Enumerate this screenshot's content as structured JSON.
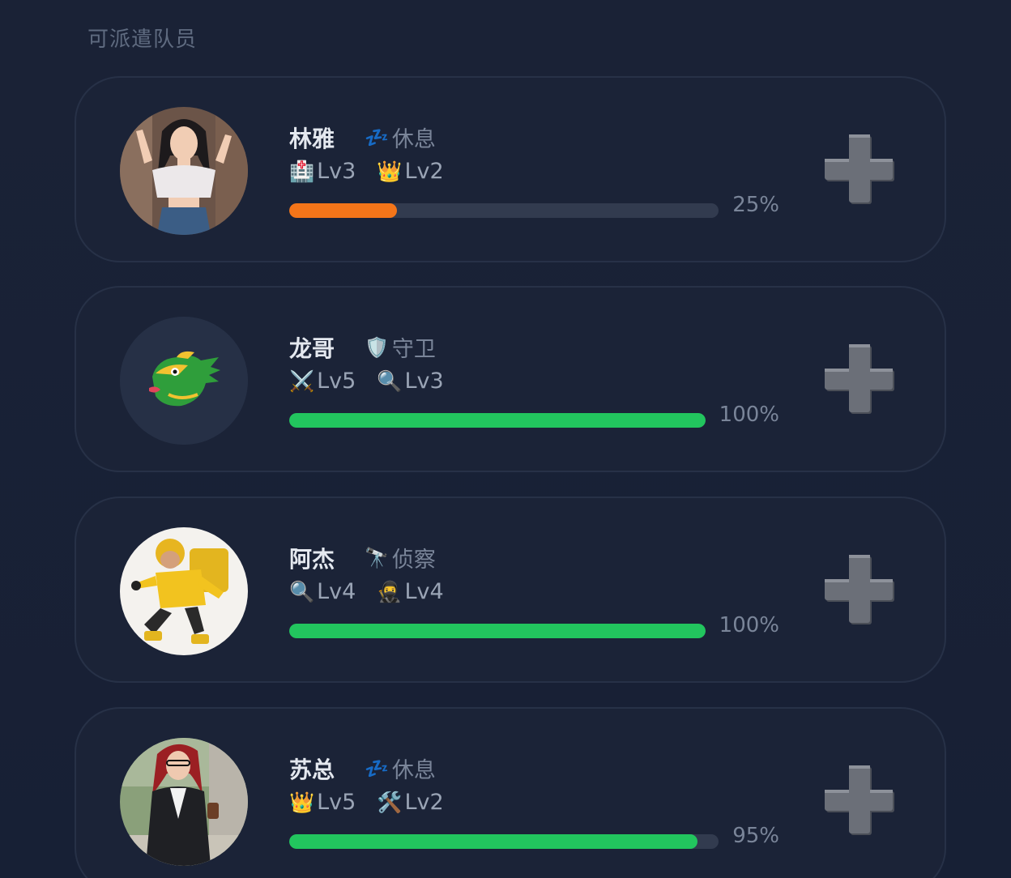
{
  "section_title": "可派遣队员",
  "colors": {
    "progress_low": "#f47519",
    "progress_high": "#22c55e"
  },
  "members": [
    {
      "name": "林雅",
      "status_icon": "zzz-sleep-icon",
      "status_glyph": "💤",
      "status": "休息",
      "skills": [
        {
          "icon": "hospital-icon",
          "glyph": "🏥",
          "label": "Lv3"
        },
        {
          "icon": "crown-icon",
          "glyph": "👑",
          "label": "Lv2"
        }
      ],
      "progress": 0.25,
      "progress_label": "25%",
      "progress_color": "#f47519",
      "avatar": "woman-photo-avatar"
    },
    {
      "name": "龙哥",
      "status_icon": "shield-icon",
      "status_glyph": "🛡️",
      "status": "守卫",
      "skills": [
        {
          "icon": "crossed-swords-icon",
          "glyph": "⚔️",
          "label": "Lv5"
        },
        {
          "icon": "magnifier-icon",
          "glyph": "🔍",
          "label": "Lv3"
        }
      ],
      "progress": 1.0,
      "progress_label": "100%",
      "progress_color": "#22c55e",
      "avatar": "dragon-emoji-avatar"
    },
    {
      "name": "阿杰",
      "status_icon": "telescope-icon",
      "status_glyph": "🔭",
      "status": "侦察",
      "skills": [
        {
          "icon": "magnifier-icon",
          "glyph": "🔍",
          "label": "Lv4"
        },
        {
          "icon": "ninja-icon",
          "glyph": "🥷",
          "label": "Lv4"
        }
      ],
      "progress": 1.0,
      "progress_label": "100%",
      "progress_color": "#22c55e",
      "avatar": "courier-photo-avatar"
    },
    {
      "name": "苏总",
      "status_icon": "zzz-sleep-icon",
      "status_glyph": "💤",
      "status": "休息",
      "skills": [
        {
          "icon": "crown-icon",
          "glyph": "👑",
          "label": "Lv5"
        },
        {
          "icon": "hammer-wrench-icon",
          "glyph": "🛠️",
          "label": "Lv2"
        }
      ],
      "progress": 0.95,
      "progress_label": "95%",
      "progress_color": "#22c55e",
      "avatar": "businesswoman-photo-avatar"
    }
  ]
}
